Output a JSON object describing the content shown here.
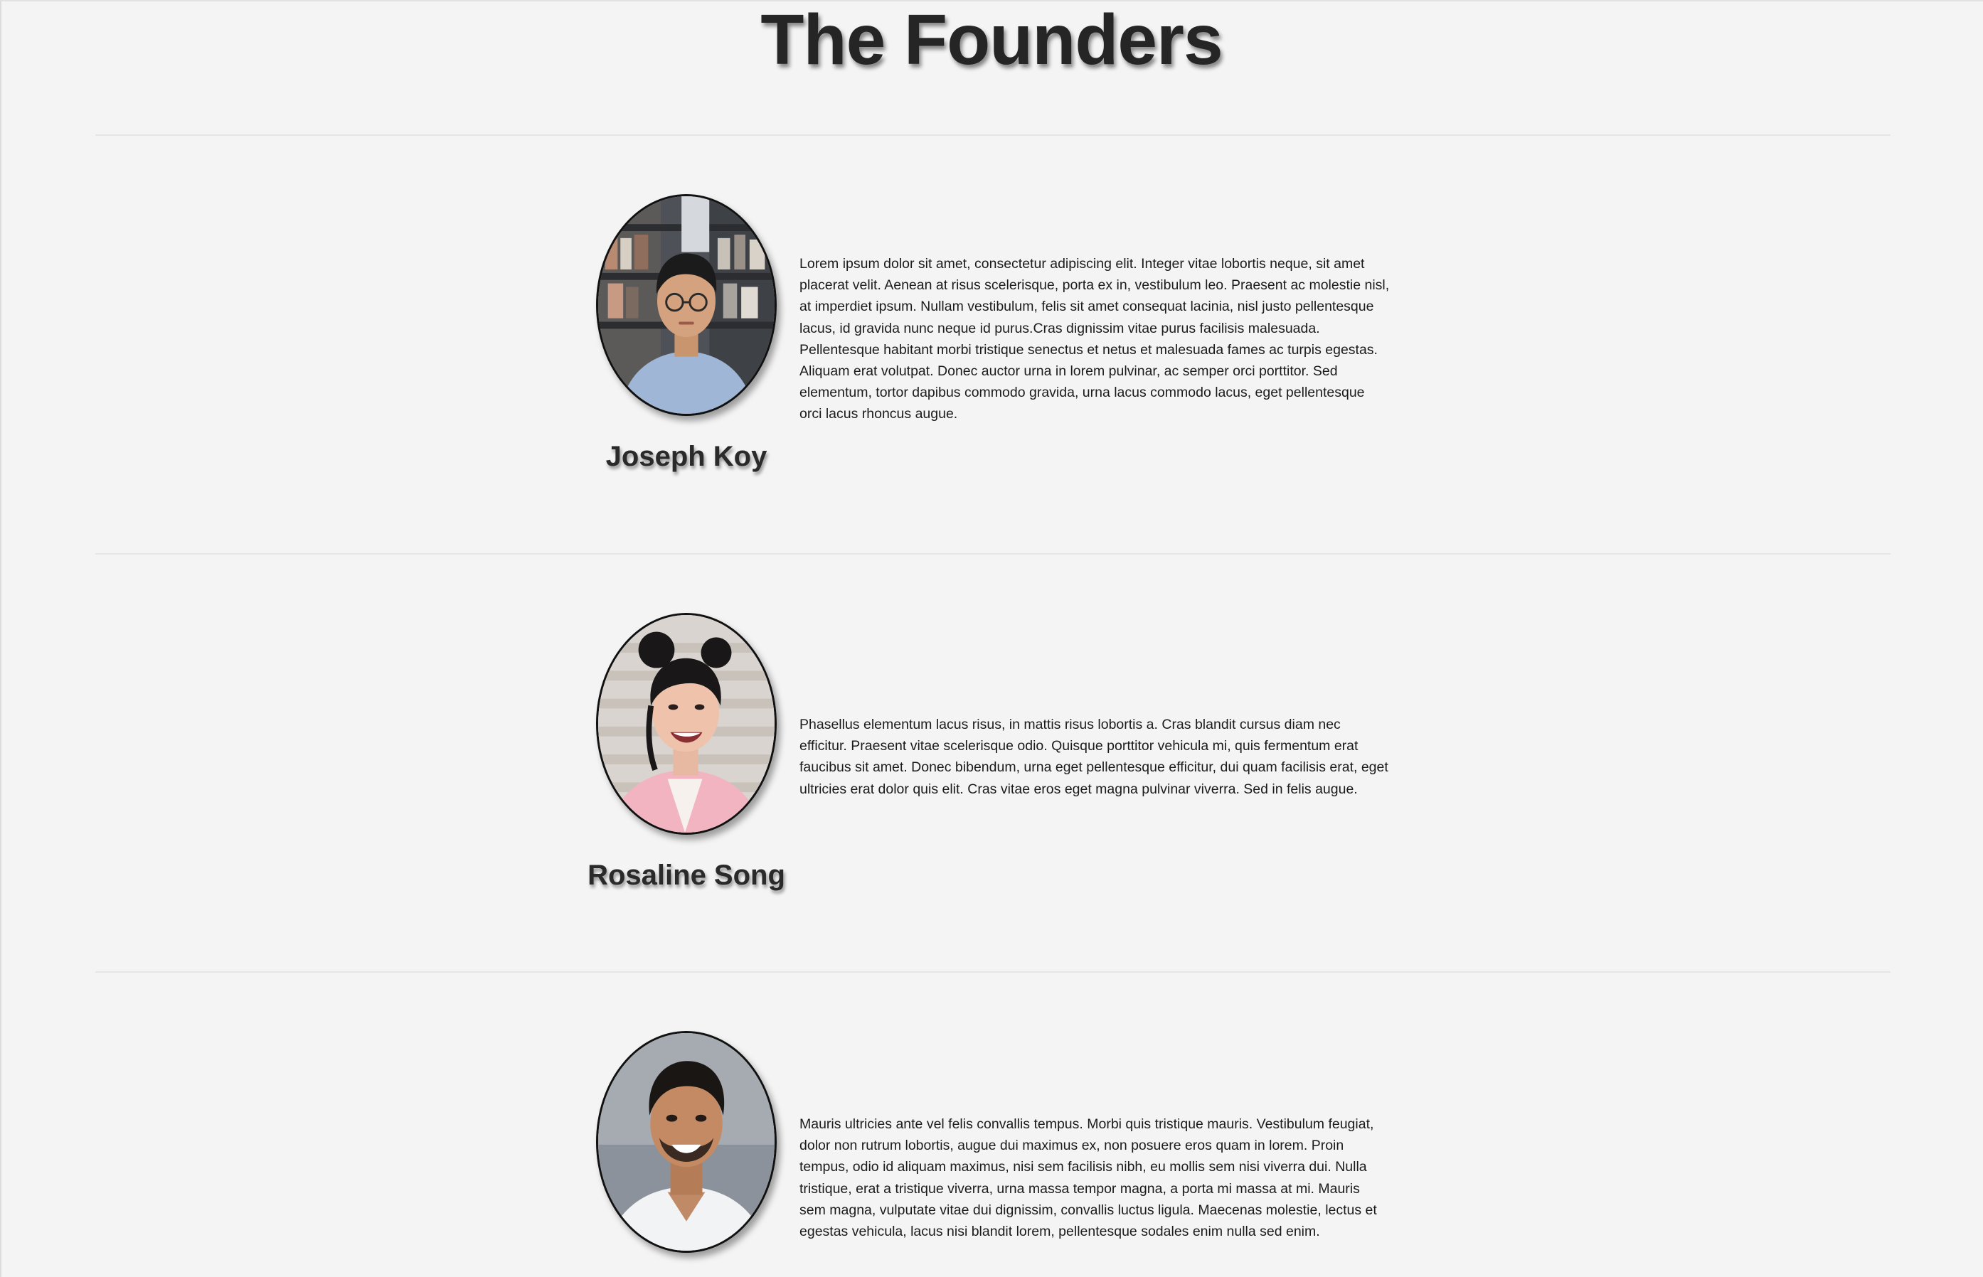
{
  "page": {
    "title": "The Founders"
  },
  "founders": [
    {
      "name": "Joseph Koy",
      "photo_icon": "founder-portrait-joseph",
      "bio": "Lorem ipsum dolor sit amet, consectetur adipiscing elit. Integer vitae lobortis neque, sit amet placerat velit. Aenean at risus scelerisque, porta ex in, vestibulum leo. Praesent ac molestie nisl, at imperdiet ipsum. Nullam vestibulum, felis sit amet consequat lacinia, nisl justo pellentesque lacus, id gravida nunc neque id purus.Cras dignissim vitae purus facilisis malesuada. Pellentesque habitant morbi tristique senectus et netus et malesuada fames ac turpis egestas. Aliquam erat volutpat. Donec auctor urna in lorem pulvinar, ac semper orci porttitor. Sed elementum, tortor dapibus commodo gravida, urna lacus commodo lacus, eget pellentesque orci lacus rhoncus augue."
    },
    {
      "name": "Rosaline Song",
      "photo_icon": "founder-portrait-rosaline",
      "bio": "Phasellus elementum lacus risus, in mattis risus lobortis a. Cras blandit cursus diam nec efficitur. Praesent vitae scelerisque odio. Quisque porttitor vehicula mi, quis fermentum erat faucibus sit amet. Donec bibendum, urna eget pellentesque efficitur, dui quam facilisis erat, eget ultricies erat dolor quis elit. Cras vitae eros eget magna pulvinar viverra. Sed in felis augue."
    },
    {
      "name": "",
      "photo_icon": "founder-portrait-third",
      "bio": "Mauris ultricies ante vel felis convallis tempus. Morbi quis tristique mauris. Vestibulum feugiat, dolor non rutrum lobortis, augue dui maximus ex, non posuere eros quam in lorem. Proin tempus, odio id aliquam maximus, nisi sem facilisis nibh, eu mollis sem nisi viverra dui. Nulla tristique, erat a tristique viverra, urna massa tempor magna, a porta mi massa at mi. Mauris sem magna, vulputate vitae dui dignissim, convallis luctus ligula. Maecenas molestie, lectus et egestas vehicula, lacus nisi blandit lorem, pellentesque sodales enim nulla sed enim."
    }
  ],
  "colors": {
    "background": "#f4f4f4",
    "text": "#1b1b1b",
    "heading": "#252525",
    "divider": "#e6e6e6"
  }
}
